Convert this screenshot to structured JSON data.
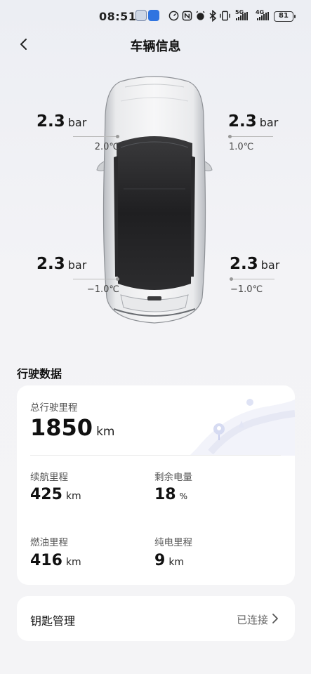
{
  "status_bar": {
    "time": "08:51",
    "network_5g": "5G",
    "network_4g": "4G",
    "battery": "81",
    "icons": [
      "app-icon-1",
      "app-icon-2",
      "speedometer-icon",
      "nfc-icon",
      "alarm-icon",
      "bluetooth-icon",
      "vibrate-icon"
    ]
  },
  "header": {
    "title": "车辆信息",
    "back_icon": "chevron-left-icon"
  },
  "tires": {
    "front_left": {
      "pressure": "2.3",
      "unit": "bar",
      "temp": "2.0℃"
    },
    "front_right": {
      "pressure": "2.3",
      "unit": "bar",
      "temp": "1.0℃"
    },
    "rear_left": {
      "pressure": "2.3",
      "unit": "bar",
      "temp": "−1.0℃"
    },
    "rear_right": {
      "pressure": "2.3",
      "unit": "bar",
      "temp": "−1.0℃"
    }
  },
  "driving": {
    "title": "行驶数据",
    "total": {
      "label": "总行驶里程",
      "value": "1850",
      "unit": "km"
    },
    "range": {
      "label": "续航里程",
      "value": "425",
      "unit": "km"
    },
    "battery": {
      "label": "剩余电量",
      "value": "18",
      "unit": "%"
    },
    "fuel_range": {
      "label": "燃油里程",
      "value": "416",
      "unit": "km"
    },
    "electric_range": {
      "label": "纯电里程",
      "value": "9",
      "unit": "km"
    }
  },
  "key": {
    "label": "钥匙管理",
    "status": "已连接"
  },
  "colors": {
    "background": "#f3f3f6",
    "card": "#ffffff",
    "text_primary": "#111111",
    "text_secondary": "#555555"
  }
}
